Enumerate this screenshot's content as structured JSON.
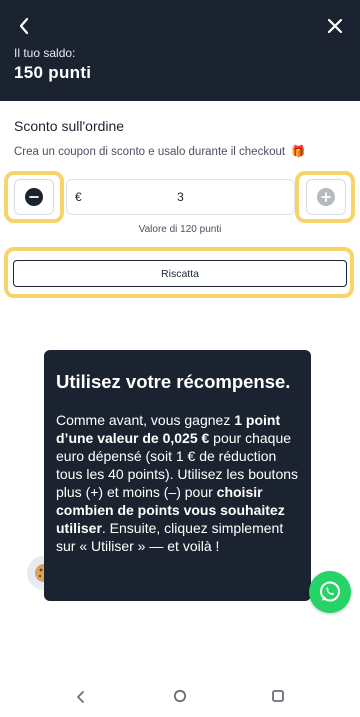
{
  "header": {
    "balance_label": "Il tuo saldo:",
    "points": "150 punti",
    "background_color": "#1b2331"
  },
  "discount": {
    "title": "Sconto sull'ordine",
    "subtitle": "Crea un coupon di sconto e usalo durante il checkout",
    "subtitle_icon": "gift-icon",
    "currency": "€",
    "amount": "3",
    "value_note": "Valore di 120 punti",
    "redeem_label": "Riscatta",
    "highlight_color": "#f7d36a"
  },
  "tooltip": {
    "title": "Utilisez votre récompense.",
    "body": {
      "p1": "Comme avant, vous gagnez ",
      "b1": "1 point d’une valeur de 0,025 €",
      "p2": " pour chaque euro dépensé (soit 1 € de réduction tous les 40 points). Utilisez les boutons plus (+) et moins (–) pour ",
      "b2": "choisir combien de points vous souhaitez utiliser",
      "p3": ". Ensuite, cliquez simplement sur « Utiliser » — et voilà !"
    }
  },
  "floating": {
    "cookie_icon": "cookie-icon",
    "chat_icon": "whatsapp-icon",
    "chat_color": "#25d366"
  },
  "navbar": {
    "back_icon": "nav-back-icon",
    "home_icon": "nav-home-icon",
    "recent_icon": "nav-recent-icon"
  }
}
